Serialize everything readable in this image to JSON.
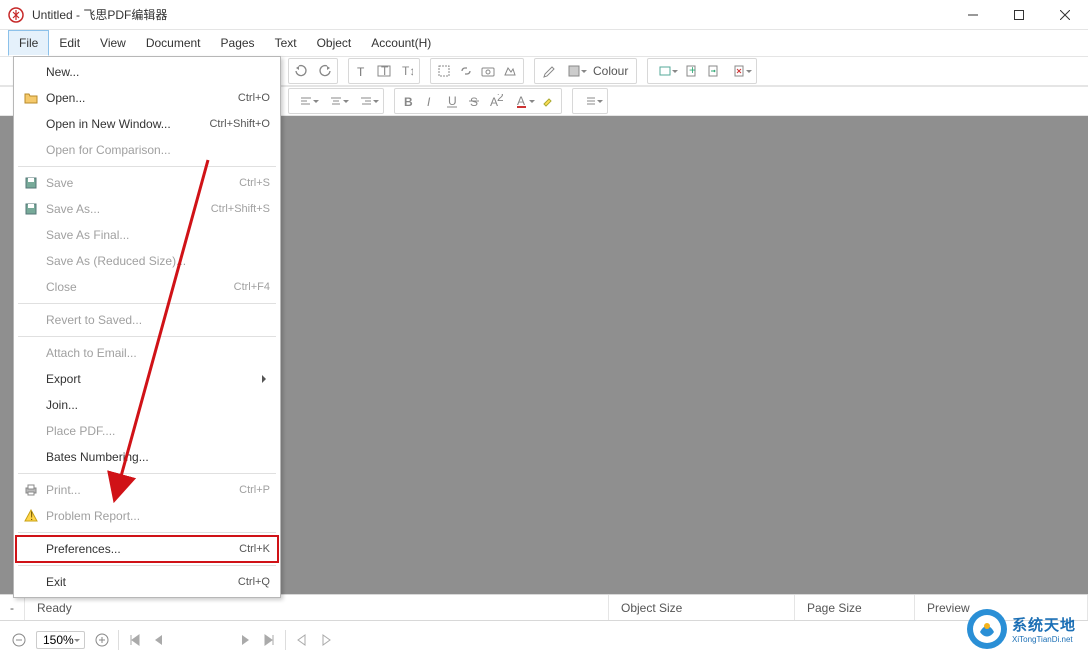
{
  "title": "Untitled - 飞思PDF编辑器",
  "menubar": [
    "File",
    "Edit",
    "View",
    "Document",
    "Pages",
    "Text",
    "Object",
    "Account(H)"
  ],
  "toolbar2_colour_label": "Colour",
  "file_menu": [
    {
      "type": "item",
      "label": "New...",
      "shortcut": "",
      "icon": "",
      "enabled": true
    },
    {
      "type": "item",
      "label": "Open...",
      "shortcut": "Ctrl+O",
      "icon": "open",
      "enabled": true
    },
    {
      "type": "item",
      "label": "Open in New Window...",
      "shortcut": "Ctrl+Shift+O",
      "icon": "",
      "enabled": true
    },
    {
      "type": "item",
      "label": "Open for Comparison...",
      "shortcut": "",
      "icon": "",
      "enabled": false
    },
    {
      "type": "sep"
    },
    {
      "type": "item",
      "label": "Save",
      "shortcut": "Ctrl+S",
      "icon": "save",
      "enabled": false
    },
    {
      "type": "item",
      "label": "Save As...",
      "shortcut": "Ctrl+Shift+S",
      "icon": "save",
      "enabled": false
    },
    {
      "type": "item",
      "label": "Save As Final...",
      "shortcut": "",
      "icon": "",
      "enabled": false
    },
    {
      "type": "item",
      "label": "Save As (Reduced Size)...",
      "shortcut": "",
      "icon": "",
      "enabled": false
    },
    {
      "type": "item",
      "label": "Close",
      "shortcut": "Ctrl+F4",
      "icon": "",
      "enabled": false
    },
    {
      "type": "sep"
    },
    {
      "type": "item",
      "label": "Revert to Saved...",
      "shortcut": "",
      "icon": "",
      "enabled": false
    },
    {
      "type": "sep"
    },
    {
      "type": "item",
      "label": "Attach to Email...",
      "shortcut": "",
      "icon": "",
      "enabled": false
    },
    {
      "type": "item",
      "label": "Export",
      "shortcut": "",
      "icon": "",
      "enabled": true,
      "submenu": true
    },
    {
      "type": "item",
      "label": "Join...",
      "shortcut": "",
      "icon": "",
      "enabled": true
    },
    {
      "type": "item",
      "label": "Place PDF....",
      "shortcut": "",
      "icon": "",
      "enabled": false
    },
    {
      "type": "item",
      "label": "Bates Numbering...",
      "shortcut": "",
      "icon": "",
      "enabled": true
    },
    {
      "type": "sep"
    },
    {
      "type": "item",
      "label": "Print...",
      "shortcut": "Ctrl+P",
      "icon": "print",
      "enabled": false
    },
    {
      "type": "item",
      "label": "Problem Report...",
      "shortcut": "",
      "icon": "warn",
      "enabled": false
    },
    {
      "type": "sep"
    },
    {
      "type": "item",
      "label": "Preferences...",
      "shortcut": "Ctrl+K",
      "icon": "",
      "enabled": true,
      "highlight": true
    },
    {
      "type": "sep"
    },
    {
      "type": "item",
      "label": "Exit",
      "shortcut": "Ctrl+Q",
      "icon": "",
      "enabled": true
    }
  ],
  "status": {
    "ready": "Ready",
    "object_size": "Object Size",
    "page_size": "Page Size",
    "preview": "Preview"
  },
  "zoom": "150%",
  "watermark": {
    "cn": "系统天地",
    "en": "XiTongTianDi.net"
  }
}
